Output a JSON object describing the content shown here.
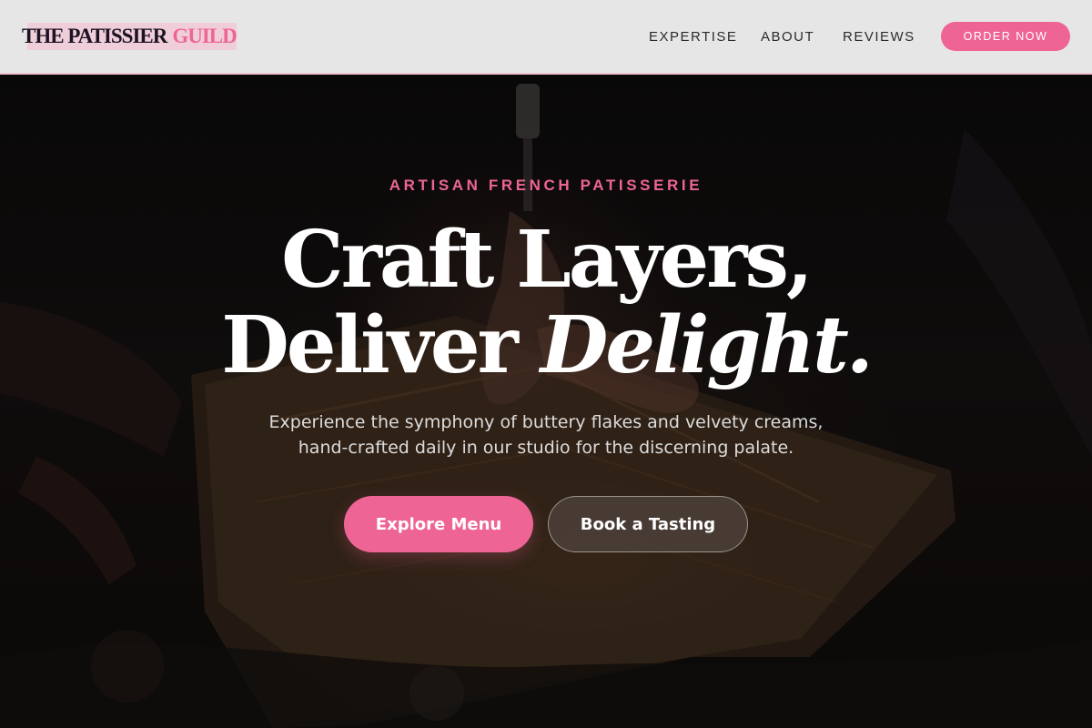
{
  "header": {
    "logo_main": "THE PATISSIER",
    "logo_accent": "GUILD",
    "nav": [
      "EXPERTISE",
      "ABOUT",
      "REVIEWS"
    ],
    "order_button": "ORDER NOW"
  },
  "hero": {
    "eyebrow": "ARTISAN FRENCH PATISSERIE",
    "headline_line1": "Craft Layers,",
    "headline_line2_start": "Deliver ",
    "headline_line2_italic": "Delight.",
    "description_line1": "Experience the symphony of buttery flakes and velvety creams,",
    "description_line2": "hand-crafted daily in our studio for the discerning palate.",
    "primary_button": "Explore Menu",
    "secondary_button": "Book a Tasting"
  },
  "colors": {
    "accent": "#ee6595",
    "header_bg": "#e7e6e6",
    "logo_dark": "#1b1422",
    "hero_text": "#ffffff"
  }
}
